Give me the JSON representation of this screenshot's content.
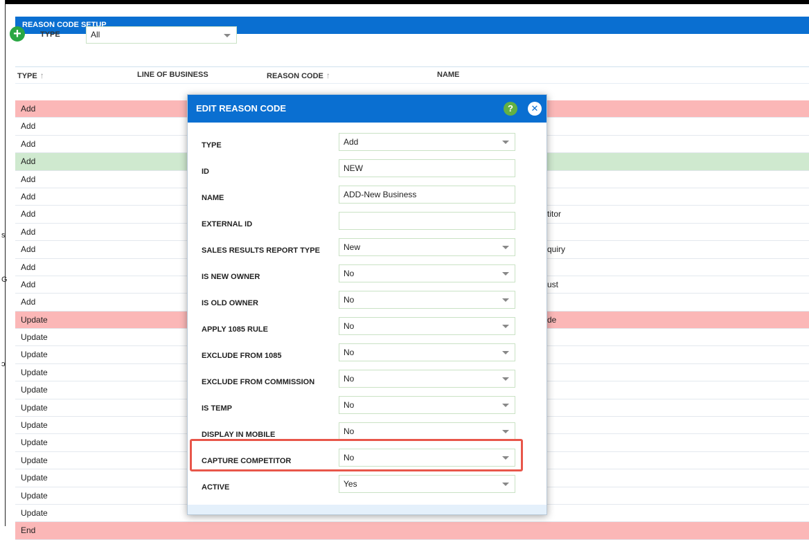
{
  "page": {
    "title": "REASON CODE SETUP",
    "filter_label": "TYPE",
    "filter_value": "All",
    "columns": {
      "type": "TYPE",
      "line_of_business": "LINE OF BUSINESS",
      "reason_code": "REASON CODE",
      "name": "NAME"
    }
  },
  "rows": [
    {
      "type": "Add",
      "name": "",
      "color": "#fbb7b7"
    },
    {
      "type": "Add",
      "name": ""
    },
    {
      "type": "Add",
      "name": ""
    },
    {
      "type": "Add",
      "name": "",
      "color": "#cfe9cf"
    },
    {
      "type": "Add",
      "name": ""
    },
    {
      "type": "Add",
      "name": ""
    },
    {
      "type": "Add",
      "name": "titor"
    },
    {
      "type": "Add",
      "name": ""
    },
    {
      "type": "Add",
      "name": "quiry"
    },
    {
      "type": "Add",
      "name": ""
    },
    {
      "type": "Add",
      "name": "ust"
    },
    {
      "type": "Add",
      "name": ""
    },
    {
      "type": "Update",
      "name": "de",
      "color": "#fbb7b7"
    },
    {
      "type": "Update",
      "name": ""
    },
    {
      "type": "Update",
      "name": ""
    },
    {
      "type": "Update",
      "name": ""
    },
    {
      "type": "Update",
      "name": ""
    },
    {
      "type": "Update",
      "name": ""
    },
    {
      "type": "Update",
      "name": ""
    },
    {
      "type": "Update",
      "name": ""
    },
    {
      "type": "Update",
      "name": ""
    },
    {
      "type": "Update",
      "name": ""
    },
    {
      "type": "Update",
      "name": ""
    },
    {
      "type": "Update",
      "name": ""
    },
    {
      "type": "End",
      "name": "",
      "color": "#fbb7b7"
    }
  ],
  "modal": {
    "title": "EDIT REASON CODE",
    "help_glyph": "?",
    "close_glyph": "✕",
    "fields": [
      {
        "label": "TYPE",
        "value": "Add",
        "control": "select"
      },
      {
        "label": "ID",
        "value": "NEW",
        "control": "input"
      },
      {
        "label": "NAME",
        "value": "ADD-New Business",
        "control": "input"
      },
      {
        "label": "EXTERNAL ID",
        "value": "",
        "control": "input"
      },
      {
        "label": "SALES RESULTS REPORT TYPE",
        "value": "New",
        "control": "select"
      },
      {
        "label": "IS NEW OWNER",
        "value": "No",
        "control": "select"
      },
      {
        "label": "IS OLD OWNER",
        "value": "No",
        "control": "select"
      },
      {
        "label": "APPLY 1085 RULE",
        "value": "No",
        "control": "select"
      },
      {
        "label": "EXCLUDE FROM 1085",
        "value": "No",
        "control": "select"
      },
      {
        "label": "EXCLUDE FROM COMMISSION",
        "value": "No",
        "control": "select"
      },
      {
        "label": "IS TEMP",
        "value": "No",
        "control": "select"
      },
      {
        "label": "DISPLAY IN MOBILE",
        "value": "No",
        "control": "select"
      },
      {
        "label": "CAPTURE COMPETITOR",
        "value": "No",
        "control": "select"
      },
      {
        "label": "ACTIVE",
        "value": "Yes",
        "control": "select"
      }
    ]
  },
  "colors": {
    "header_blue": "#0a6fd1",
    "row_red": "#fbb7b7",
    "row_green": "#cfe9cf",
    "highlight_red": "#e8564a",
    "help_green": "#63b143"
  }
}
